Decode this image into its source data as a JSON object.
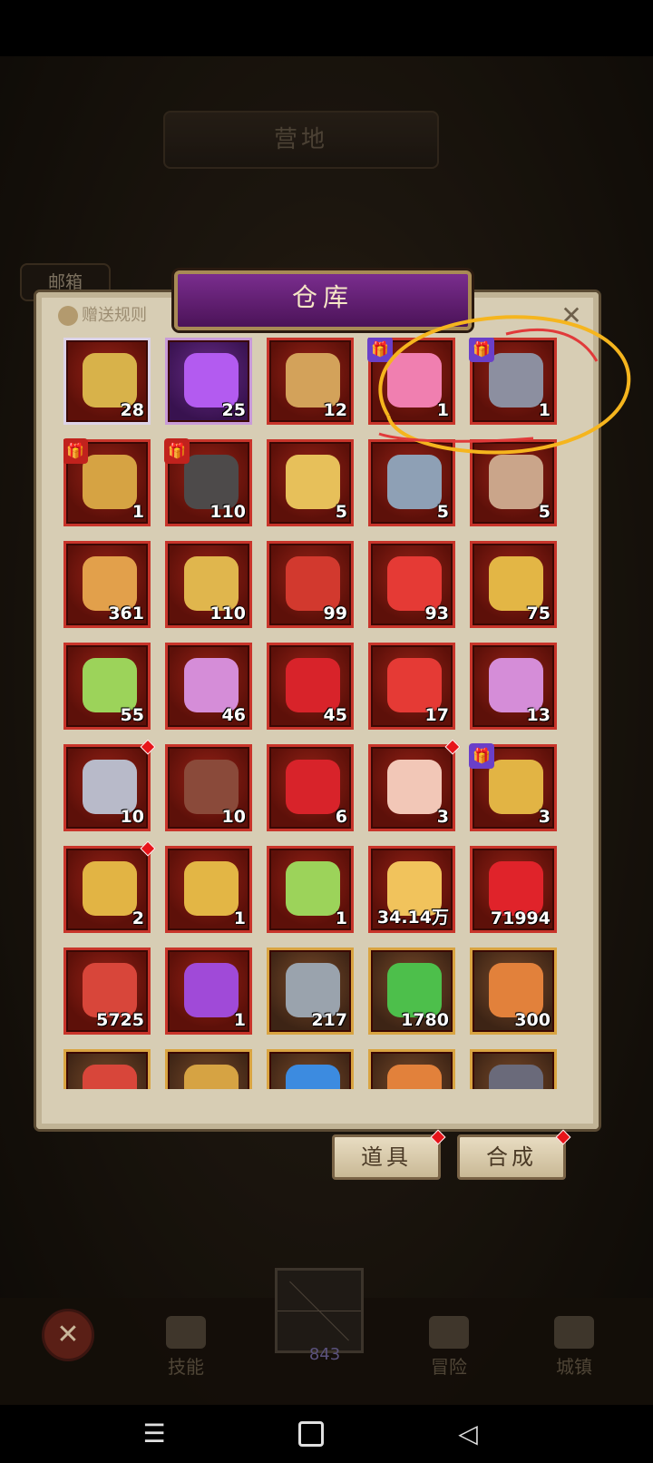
{
  "camp": {
    "title": "营地"
  },
  "mailbox": {
    "label": "邮箱"
  },
  "panel": {
    "title": "仓库",
    "rules_label": "赠送规则",
    "close": "✕"
  },
  "items": [
    {
      "qty": "28",
      "frame": "silver",
      "icon": "golden-helmet-icon",
      "color": "#d8b24a"
    },
    {
      "qty": "25",
      "frame": "purple",
      "icon": "purple-gem-icon",
      "color": "#b35bf0"
    },
    {
      "qty": "12",
      "frame": "red",
      "icon": "key-icon",
      "color": "#d3a25a"
    },
    {
      "qty": "1",
      "frame": "red",
      "icon": "pink-hair-character-icon",
      "color": "#f07fb0",
      "gift": "purple"
    },
    {
      "qty": "1",
      "frame": "red",
      "icon": "atm-card-icon",
      "color": "#8c8fa0",
      "gift": "purple"
    },
    {
      "qty": "1",
      "frame": "red",
      "icon": "treasure-chest-icon",
      "color": "#d6a343",
      "gift": "red"
    },
    {
      "qty": "110",
      "frame": "red",
      "icon": "dark-chest-icon",
      "color": "#4d4a4a",
      "gift": "red"
    },
    {
      "qty": "5",
      "frame": "red",
      "icon": "tiger-hood-pig-icon",
      "color": "#e7c05a"
    },
    {
      "qty": "5",
      "frame": "red",
      "icon": "hooded-old-man-icon",
      "color": "#8ea0b5"
    },
    {
      "qty": "5",
      "frame": "red",
      "icon": "dark-hair-woman-icon",
      "color": "#caa58a"
    },
    {
      "qty": "361",
      "frame": "red",
      "icon": "feather-icon",
      "color": "#e2a04b"
    },
    {
      "qty": "110",
      "frame": "red",
      "icon": "crown-icon",
      "color": "#e0b64d"
    },
    {
      "qty": "99",
      "frame": "red",
      "icon": "red-potion-bag-icon",
      "color": "#d2392e"
    },
    {
      "qty": "93",
      "frame": "red",
      "icon": "red-orb-icon",
      "color": "#e53a35"
    },
    {
      "qty": "75",
      "frame": "red",
      "icon": "gold-cube-icon",
      "color": "#e3b645"
    },
    {
      "qty": "55",
      "frame": "red",
      "icon": "green-orb-icon",
      "color": "#9cd35a"
    },
    {
      "qty": "46",
      "frame": "red",
      "icon": "rainbow-crystal-icon",
      "color": "#d58dd8"
    },
    {
      "qty": "45",
      "frame": "red",
      "icon": "red-crystal-icon",
      "color": "#d8232a"
    },
    {
      "qty": "17",
      "frame": "red",
      "icon": "red-orb-icon",
      "color": "#e53a35"
    },
    {
      "qty": "13",
      "frame": "red",
      "icon": "rainbow-crystal-icon",
      "color": "#d58dd8"
    },
    {
      "qty": "10",
      "frame": "red",
      "icon": "grey-creature-icon",
      "color": "#b8bac9",
      "dot": true
    },
    {
      "qty": "10",
      "frame": "red",
      "icon": "bat-creature-icon",
      "color": "#8a4a3a"
    },
    {
      "qty": "6",
      "frame": "red",
      "icon": "red-crystal-icon",
      "color": "#d8232a"
    },
    {
      "qty": "3",
      "frame": "red",
      "icon": "cupcake-icon",
      "color": "#f2c7b7",
      "dot": true
    },
    {
      "qty": "3",
      "frame": "red",
      "icon": "gift-box-icon",
      "color": "#e2b444",
      "gift": "purple"
    },
    {
      "qty": "2",
      "frame": "red",
      "icon": "gift-box-icon",
      "color": "#e2b444",
      "dot": true
    },
    {
      "qty": "1",
      "frame": "red",
      "icon": "gold-ore-icon",
      "color": "#e3b645"
    },
    {
      "qty": "1",
      "frame": "red",
      "icon": "green-orb-icon",
      "color": "#9cd35a"
    },
    {
      "qty": "34.14万",
      "frame": "red",
      "icon": "gold-crystal-icon",
      "color": "#f1c35c"
    },
    {
      "qty": "71994",
      "frame": "red",
      "icon": "ruby-icon",
      "color": "#e0232a"
    },
    {
      "qty": "5725",
      "frame": "red",
      "icon": "ruby-pendant-icon",
      "color": "#d8463a"
    },
    {
      "qty": "1",
      "frame": "red",
      "icon": "purple-orb-icon",
      "color": "#a04ad8"
    },
    {
      "qty": "217",
      "frame": "gold",
      "icon": "silver-key-icon",
      "color": "#9aa3ad"
    },
    {
      "qty": "1780",
      "frame": "gold",
      "icon": "green-potion-icon",
      "color": "#4dbf4b"
    },
    {
      "qty": "300",
      "frame": "gold",
      "icon": "orange-urn-icon",
      "color": "#e2813b"
    },
    {
      "qty": "",
      "frame": "gold",
      "icon": "red-crystal-icon",
      "color": "#d8463a"
    },
    {
      "qty": "",
      "frame": "gold",
      "icon": "amulet-icon",
      "color": "#d6a343"
    },
    {
      "qty": "",
      "frame": "gold",
      "icon": "blue-gem-icon",
      "color": "#3c8be0"
    },
    {
      "qty": "",
      "frame": "gold",
      "icon": "orange-orb-icon",
      "color": "#e2813b"
    },
    {
      "qty": "",
      "frame": "gold",
      "icon": "stone-icon",
      "color": "#6a6a7a"
    }
  ],
  "buttons": {
    "items": "道具",
    "synth": "合成"
  },
  "nav": {
    "skills": "技能",
    "count": "843",
    "adventure": "冒险",
    "town": "城镇"
  },
  "annotation_color": "#f5b51e"
}
